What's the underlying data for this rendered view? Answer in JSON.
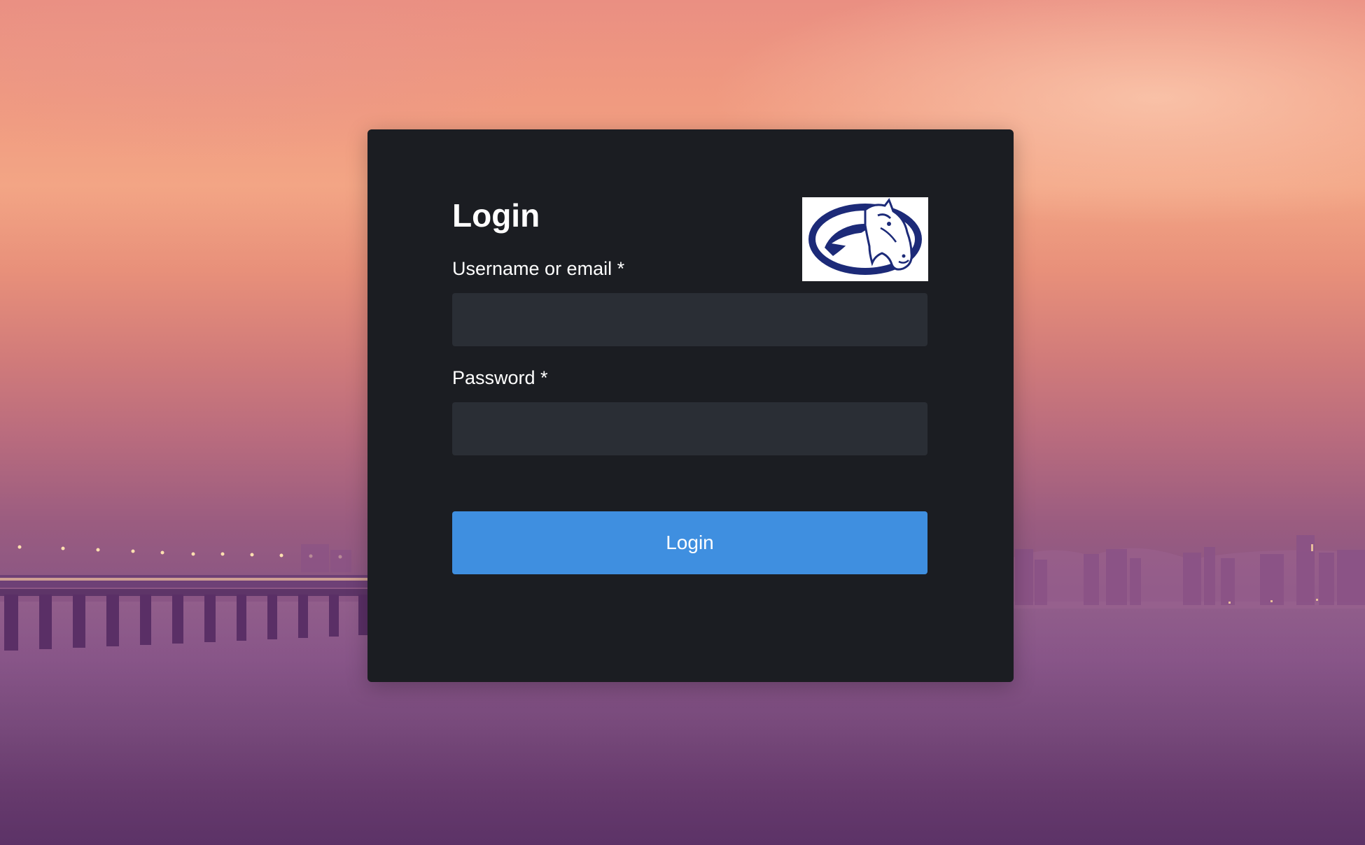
{
  "login": {
    "title": "Login",
    "username_label": "Username or email *",
    "username_value": "",
    "password_label": "Password *",
    "password_value": "",
    "submit_label": "Login"
  },
  "logo": {
    "icon": "mustang-horse-logo"
  },
  "colors": {
    "card_background": "#1b1d22",
    "input_background": "#2a2e35",
    "button_accent": "#3f8fe0",
    "logo_navy": "#1c2a78"
  }
}
